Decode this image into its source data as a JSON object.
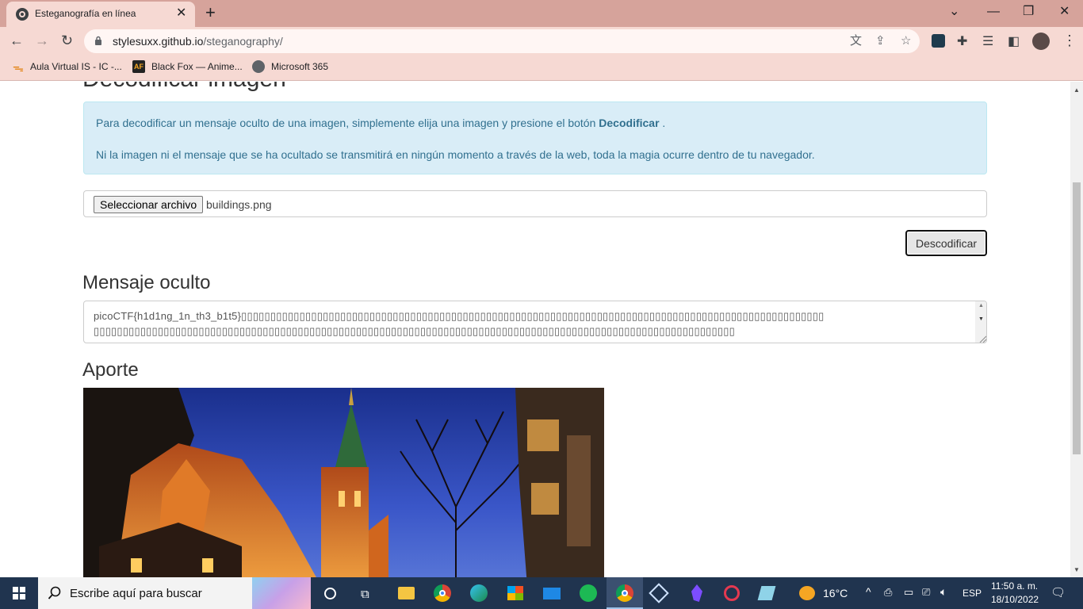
{
  "browser": {
    "tab_title": "Esteganografía en línea",
    "url_host": "stylesuxx.github.io",
    "url_path": "/steganography/",
    "bookmarks": [
      {
        "label": "Aula Virtual IS - IC -..."
      },
      {
        "label": "Black Fox — Anime..."
      },
      {
        "label": "Microsoft 365"
      }
    ]
  },
  "page": {
    "partial_heading": "Decodificar imagen",
    "alert": {
      "line1_prefix": "Para decodificar un mensaje oculto de una imagen, simplemente elija una imagen y presione el botón",
      "line1_bold": "Decodificar",
      "line1_suffix": ".",
      "line2": "Ni la imagen ni el mensaje que se ha ocultado se transmitirá en ningún momento a través de la web, toda la magia ocurre dentro de tu navegador."
    },
    "file_button_label": "Seleccionar archivo",
    "file_name": "buildings.png",
    "decode_button_label": "Descodificar",
    "hidden_message_heading": "Mensaje oculto",
    "hidden_message_value": "picoCTF{h1d1ng_1n_th3_b1t5}",
    "contribution_heading": "Aporte"
  },
  "taskbar": {
    "search_placeholder": "Escribe aquí para buscar",
    "weather": "16°C",
    "language": "ESP",
    "time": "11:50 a. m.",
    "date": "18/10/2022"
  },
  "colors": {
    "chrome_frame": "#d6a39b",
    "chrome_toolbar": "#f6d9d3",
    "alert_bg": "#d9edf7",
    "alert_text": "#31708f",
    "taskbar_bg": "#20344f"
  }
}
